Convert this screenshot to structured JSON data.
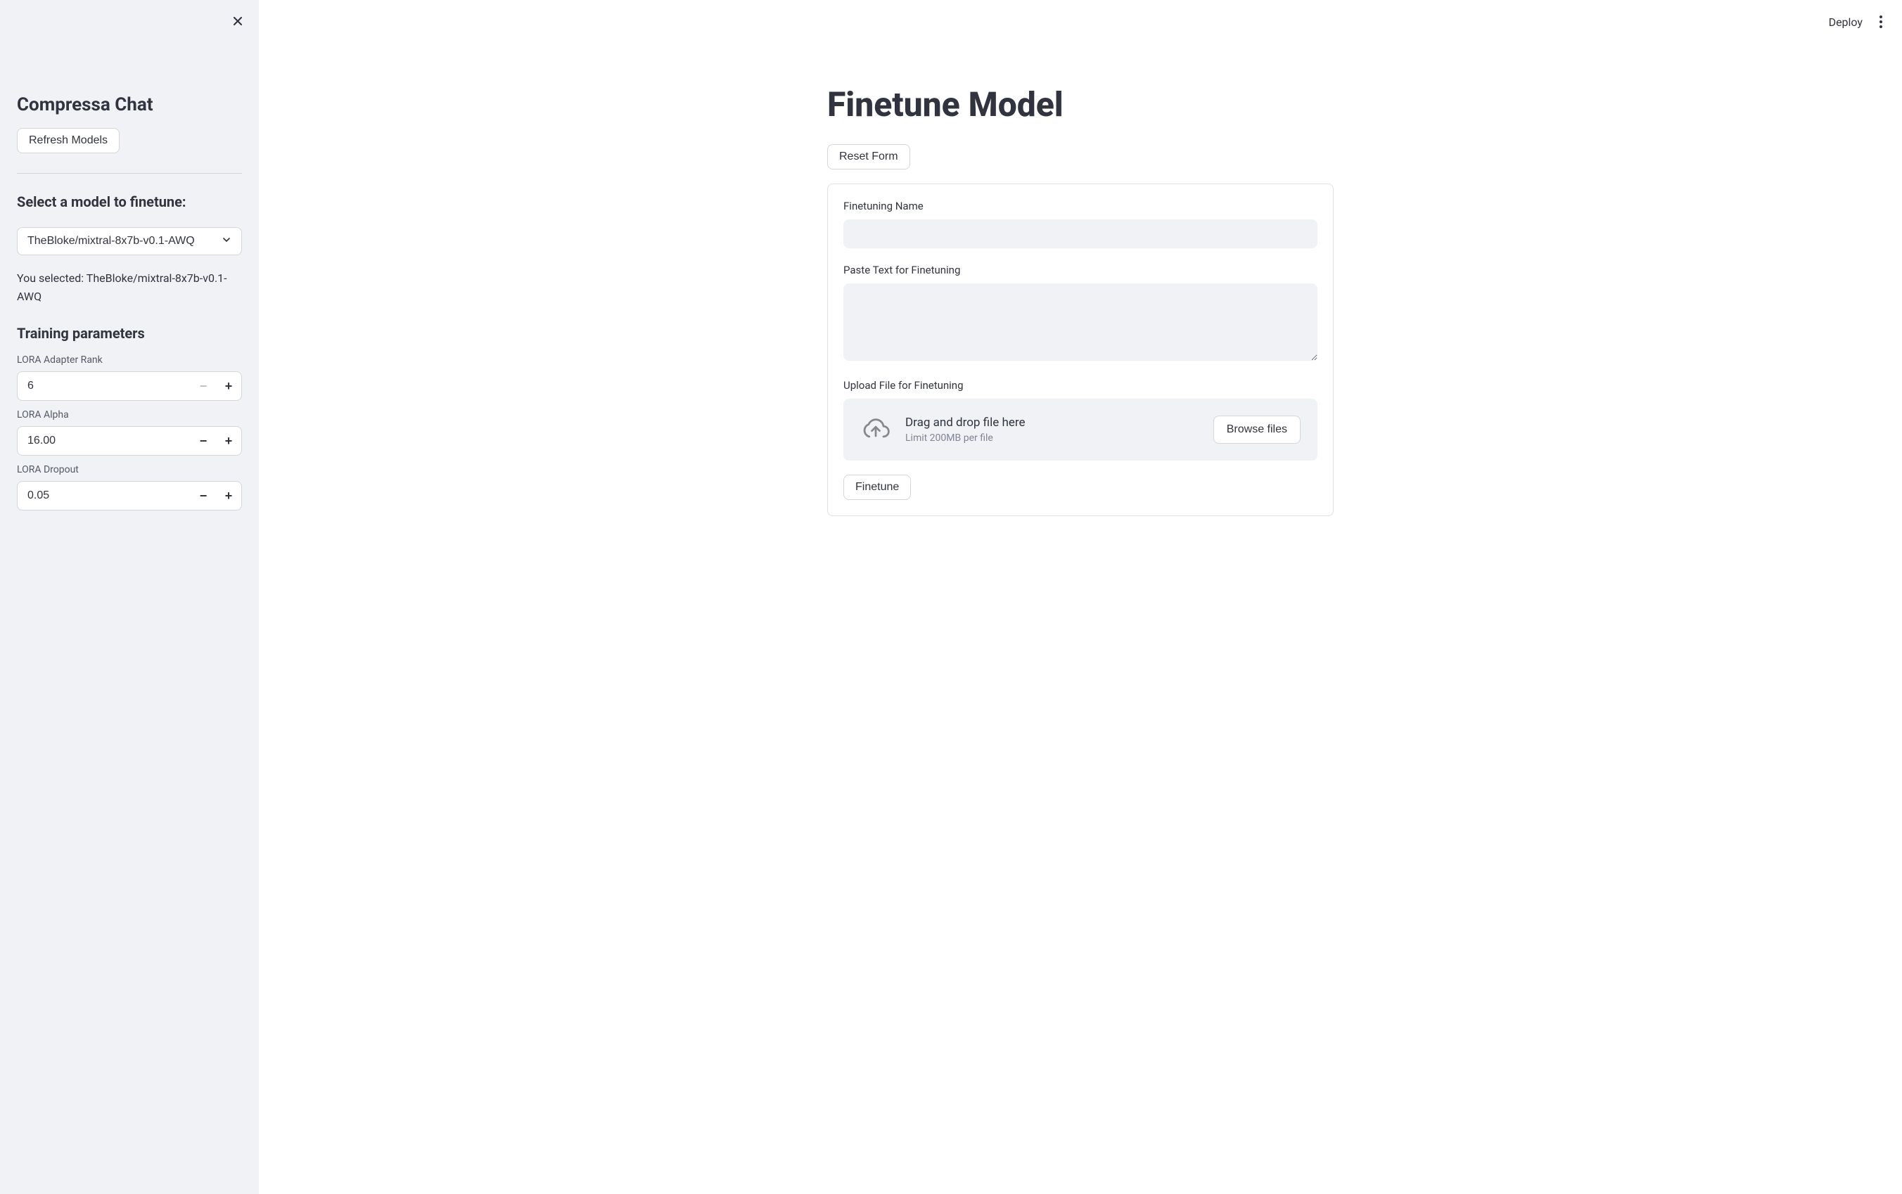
{
  "topbar": {
    "deploy_label": "Deploy"
  },
  "sidebar": {
    "title": "Compressa Chat",
    "refresh_button": "Refresh Models",
    "select_heading": "Select a model to finetune:",
    "model_selected": "TheBloke/mixtral-8x7b-v0.1-AWQ",
    "selected_prefix": "You selected: ",
    "selected_text": "You selected: TheBloke/mixtral-8x7b-v0.1-AWQ",
    "training_heading": "Training parameters",
    "params": {
      "lora_rank": {
        "label": "LORA Adapter Rank",
        "value": "6"
      },
      "lora_alpha": {
        "label": "LORA Alpha",
        "value": "16.00"
      },
      "lora_dropout": {
        "label": "LORA Dropout",
        "value": "0.05"
      }
    }
  },
  "main": {
    "page_title": "Finetune Model",
    "reset_button": "Reset Form",
    "form": {
      "name_label": "Finetuning Name",
      "name_value": "",
      "text_label": "Paste Text for Finetuning",
      "text_value": "",
      "upload_label": "Upload File for Finetuning",
      "upload_primary": "Drag and drop file here",
      "upload_secondary": "Limit 200MB per file",
      "browse_button": "Browse files",
      "submit_button": "Finetune"
    }
  }
}
